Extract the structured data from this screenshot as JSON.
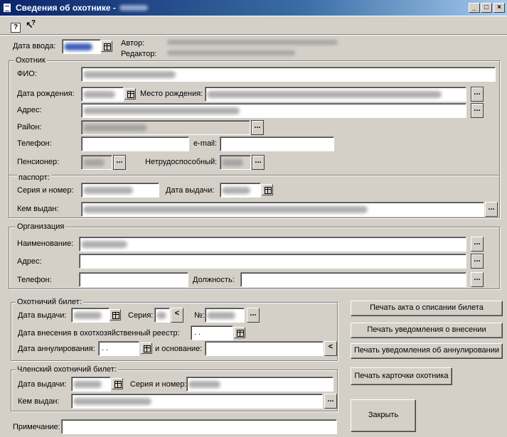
{
  "window": {
    "title": "Сведения об охотнике -",
    "minimize": "_",
    "maximize": "□",
    "close": "×"
  },
  "toolbar": {
    "help": "?",
    "whats_this": "?"
  },
  "header": {
    "entry_date_label": "Дата ввода:",
    "author_label": "Автор:",
    "editor_label": "Редактор:"
  },
  "hunter": {
    "group_title": "Охотник",
    "fio_label": "ФИО:",
    "birth_date_label": "Дата рождения:",
    "birth_place_label": "Место рождения:",
    "address_label": "Адрес:",
    "district_label": "Район:",
    "phone_label": "Телефон:",
    "email_label": "e-mail:",
    "pensioner_label": "Пенсионер:",
    "disabled_label": "Нетрудоспособный:",
    "phone_value": "",
    "email_value": ""
  },
  "passport": {
    "title": "паспорт:",
    "series_number_label": "Серия и номер:",
    "issue_date_label": "Дата выдачи:",
    "issued_by_label": "Кем выдан:"
  },
  "organization": {
    "group_title": "Организация",
    "name_label": "Наименование:",
    "address_label": "Адрес:",
    "phone_label": "Телефон:",
    "position_label": "Должность:"
  },
  "hunting_ticket": {
    "group_title": "Охотничий билет:",
    "issue_date_label": "Дата выдачи:",
    "series_label": "Серия:",
    "number_label": "№:",
    "registry_date_label": "Дата внесения в охотхозяйственный реестр:",
    "registry_date_value": " . .",
    "cancel_date_label": "Дата аннулирования:",
    "cancel_date_value": " . .",
    "reason_label": "и основание:",
    "series_arrow": "<",
    "reason_arrow": "<"
  },
  "member_ticket": {
    "group_title": "Членский охотничий билет:",
    "issue_date_label": "Дата выдачи:",
    "series_number_label": "Серия и номер:",
    "issued_by_label": "Кем выдан:"
  },
  "note_label": "Примечание:",
  "buttons": {
    "print_write_off": "Печать акта о списании билета",
    "print_notice_entry": "Печать уведомления о внесении",
    "print_notice_cancel": "Печать уведомления об аннулировании",
    "print_card": "Печать карточки охотника",
    "close": "Закрыть"
  },
  "ellipsis": "..."
}
